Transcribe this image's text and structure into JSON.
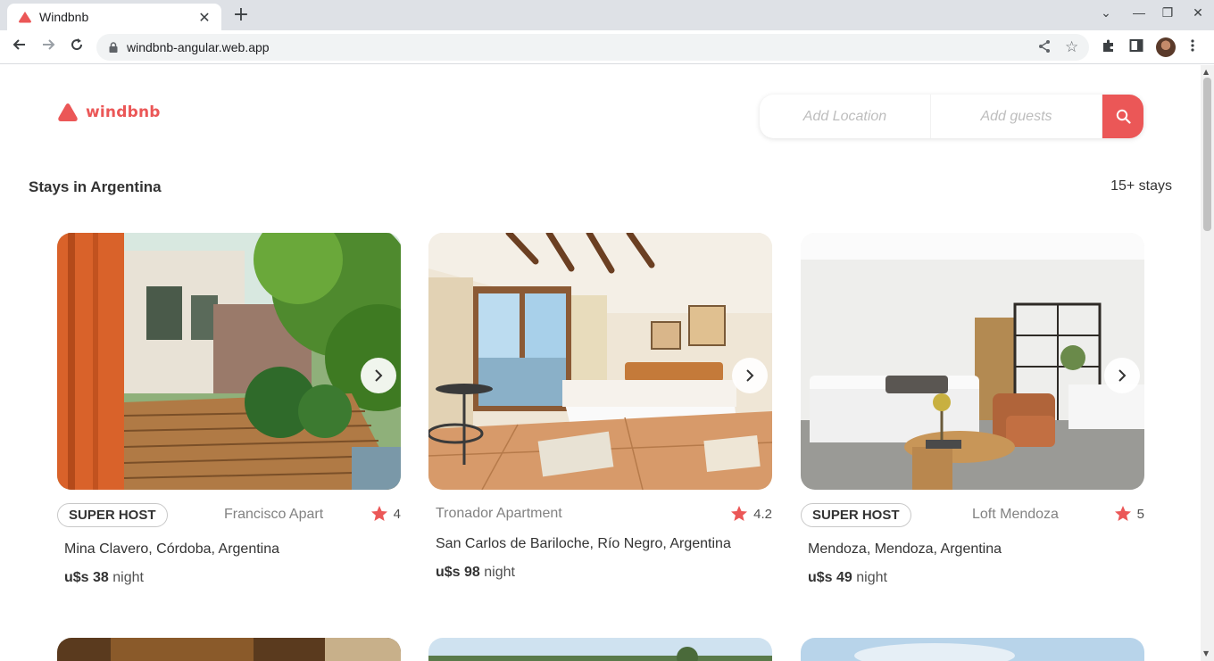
{
  "browser": {
    "tab_title": "Windbnb",
    "tab_close": "✕",
    "new_tab": "+",
    "url": "windbnb-angular.web.app",
    "controls": {
      "chevron": "⌄",
      "minimize": "—",
      "restore": "❐",
      "close": "✕"
    }
  },
  "header": {
    "logo_text": "windbnb",
    "brand_color": "#eb5757",
    "search": {
      "location_placeholder": "Add Location",
      "guests_placeholder": "Add guests"
    }
  },
  "section": {
    "title": "Stays in Argentina",
    "count": "15+ stays"
  },
  "stays": [
    {
      "super_host": "SUPER HOST",
      "type": "Francisco Apart",
      "rating": "4",
      "location": "Mina Clavero, Córdoba, Argentina",
      "price": "u$s 38",
      "unit": "night"
    },
    {
      "super_host": "",
      "type": "Tronador Apartment",
      "rating": "4.2",
      "location": "San Carlos de Bariloche, Río Negro, Argentina",
      "price": "u$s 98",
      "unit": "night"
    },
    {
      "super_host": "SUPER HOST",
      "type": "Loft Mendoza",
      "rating": "5",
      "location": "Mendoza, Mendoza, Argentina",
      "price": "u$s 49",
      "unit": "night"
    }
  ]
}
